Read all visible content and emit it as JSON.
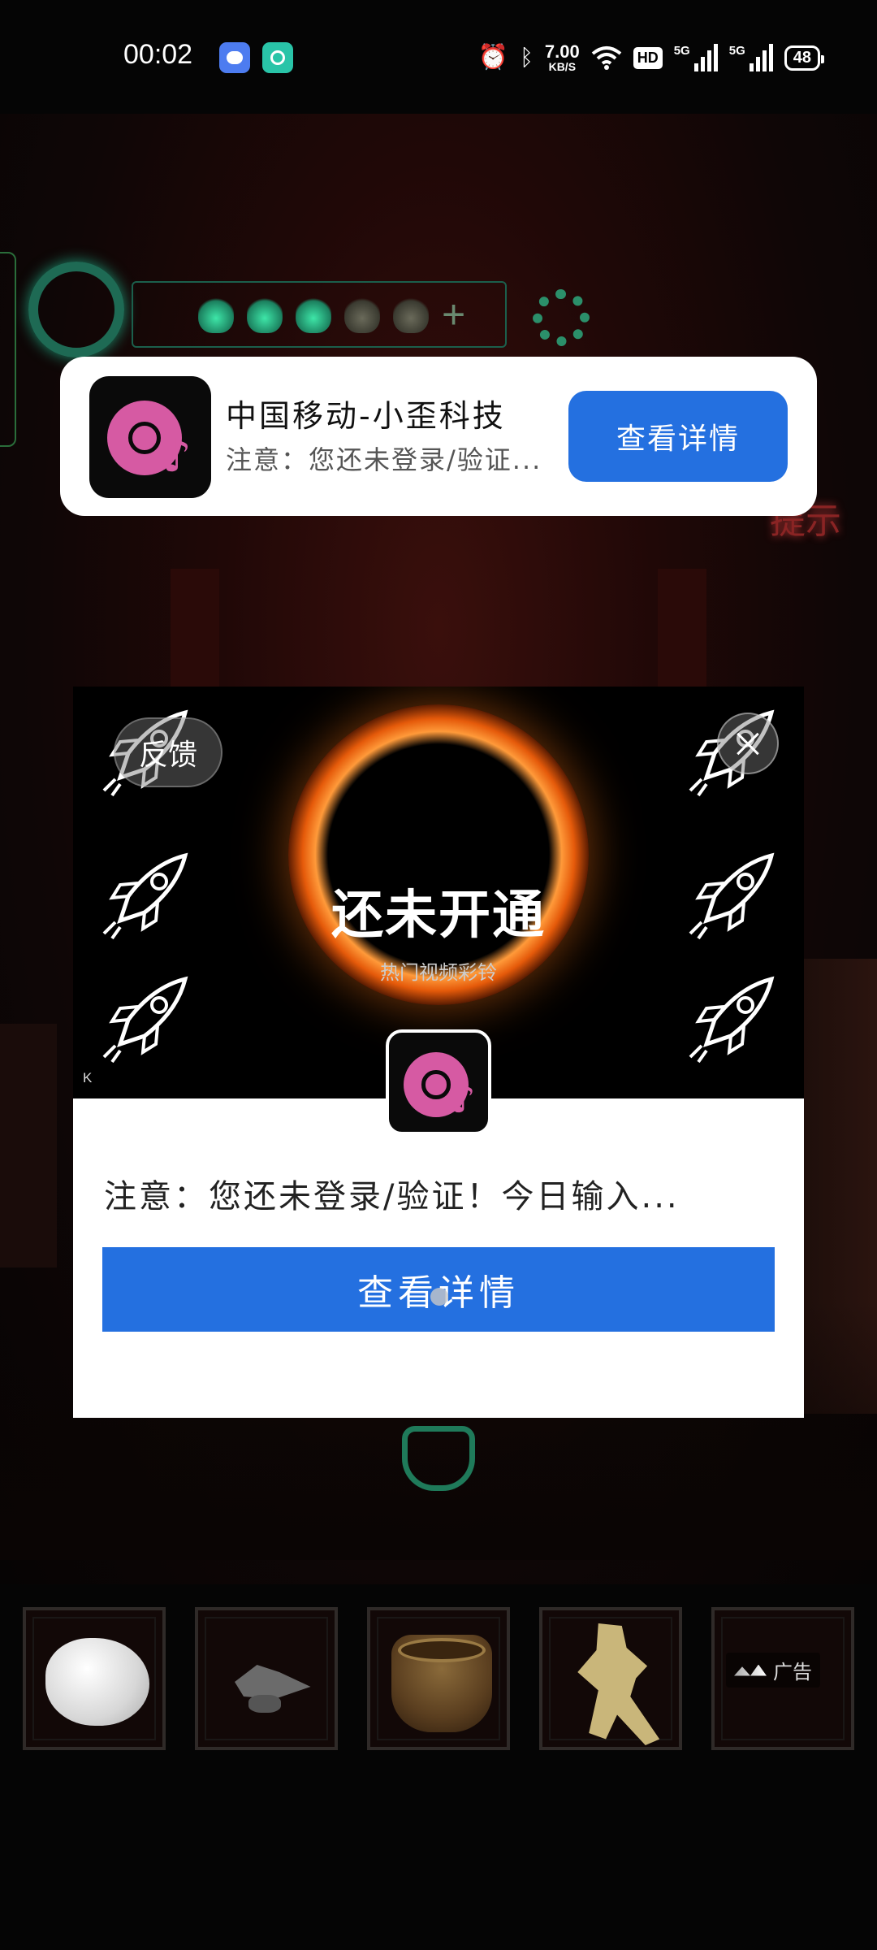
{
  "status_bar": {
    "time": "00:02",
    "net_speed_value": "7.00",
    "net_speed_unit": "KB/S",
    "hd_label": "HD",
    "signal1_label": "5G",
    "signal2_label": "5G",
    "battery": "48"
  },
  "notification": {
    "title": "中国移动-小歪科技",
    "text": "注意：您还未登录/验证...",
    "button_label": "查看详情"
  },
  "ad": {
    "feedback_label": "反馈",
    "headline": "还未开通",
    "subheadline": "热门视频彩铃",
    "corner_mark": "K",
    "text": "注意：您还未登录/验证！今日输入...",
    "button_label": "查看详情"
  },
  "inventory": {
    "ad_tag": "广告"
  },
  "colors": {
    "button_blue": "#2470e0",
    "brand_pink": "#d65aa3",
    "game_glow_green": "#2b8f6a"
  }
}
